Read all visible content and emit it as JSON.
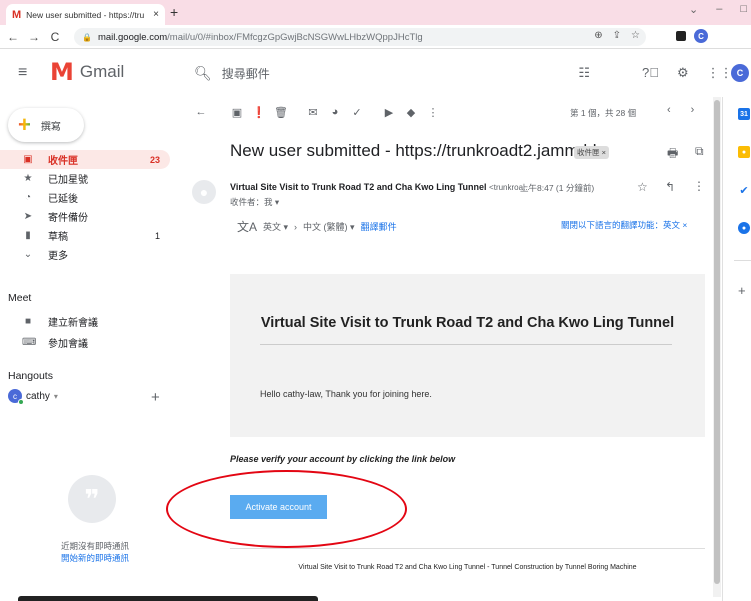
{
  "browser": {
    "tab_title": "New user submitted - https://tru",
    "tab_favicon": "M",
    "tab_close": "×",
    "new_tab": "+",
    "url_host": "mail.google.com",
    "url_path": "/mail/u/0/#inbox/FMfcgzGpGwjBcNSGWwLHbzWQppJHcTlg",
    "profile_initial": "C"
  },
  "gmail": {
    "app_name": "Gmail",
    "search_placeholder": "搜尋郵件",
    "avatar_initial": "C"
  },
  "sidebar": {
    "compose_label": "撰寫",
    "items": [
      {
        "label": "收件匣",
        "count": "23",
        "icon": "inbox-icon"
      },
      {
        "label": "已加星號",
        "count": "",
        "icon": "star-icon"
      },
      {
        "label": "已延後",
        "count": "",
        "icon": "clock-icon"
      },
      {
        "label": "寄件備份",
        "count": "",
        "icon": "send-icon"
      },
      {
        "label": "草稿",
        "count": "1",
        "icon": "draft-icon"
      },
      {
        "label": "更多",
        "count": "",
        "icon": "chevron-down-icon"
      }
    ],
    "meet_title": "Meet",
    "meet_items": [
      {
        "label": "建立新會議",
        "icon": "video-icon"
      },
      {
        "label": "參加會議",
        "icon": "keyboard-icon"
      }
    ],
    "hangouts_title": "Hangouts",
    "hangouts_user": "cathy",
    "hangouts_user_initial": "c",
    "no_chats": "近期沒有即時通訊",
    "start_chat": "開始新的即時通訊"
  },
  "toolbar": {
    "pager": "第 1 個，共 28 個"
  },
  "message": {
    "subject": "New user submitted - https://trunkroadt2.jamm.hk",
    "label_chip": "收件匣 ×",
    "sender_name": "Virtual Site Visit to Trunk Road T2 and Cha Kwo Ling Tunnel",
    "sender_email": "<trunkroa...",
    "time": "上午8:47 (1 分鐘前)",
    "to": "收件者：我 ▾"
  },
  "translate": {
    "from_lang": "英文 ▾",
    "arrow": "›",
    "to_lang": "中文 (繁體) ▾",
    "translate_link": "翻譯郵件",
    "turn_off": "關閉以下語言的翻譯功能：英文 ×"
  },
  "email": {
    "heading": "Virtual Site Visit to Trunk Road T2 and Cha Kwo Ling Tunnel",
    "greeting": "Hello cathy-law, Thank you for joining here.",
    "verify_text": "Please verify your account by clicking the link below",
    "button_label": "Activate account",
    "footer": "Virtual Site Visit to Trunk Road T2 and Cha Kwo Ling Tunnel - Tunnel Construction by Tunnel Boring Machine"
  },
  "colors": {
    "accent_red": "#d93025",
    "button_blue": "#5aabf0",
    "annotation_red": "#e30613",
    "link_blue": "#1a73e8"
  }
}
